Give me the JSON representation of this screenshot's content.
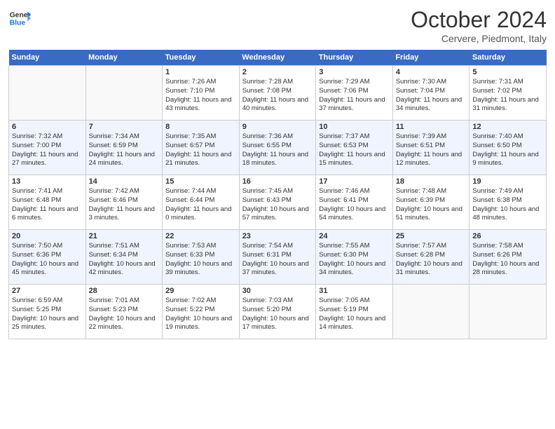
{
  "header": {
    "logo_line1": "General",
    "logo_line2": "Blue",
    "title": "October 2024",
    "location": "Cervere, Piedmont, Italy"
  },
  "weekdays": [
    "Sunday",
    "Monday",
    "Tuesday",
    "Wednesday",
    "Thursday",
    "Friday",
    "Saturday"
  ],
  "weeks": [
    [
      {
        "day": "",
        "info": ""
      },
      {
        "day": "",
        "info": ""
      },
      {
        "day": "1",
        "info": "Sunrise: 7:26 AM\nSunset: 7:10 PM\nDaylight: 11 hours and 43 minutes."
      },
      {
        "day": "2",
        "info": "Sunrise: 7:28 AM\nSunset: 7:08 PM\nDaylight: 11 hours and 40 minutes."
      },
      {
        "day": "3",
        "info": "Sunrise: 7:29 AM\nSunset: 7:06 PM\nDaylight: 11 hours and 37 minutes."
      },
      {
        "day": "4",
        "info": "Sunrise: 7:30 AM\nSunset: 7:04 PM\nDaylight: 11 hours and 34 minutes."
      },
      {
        "day": "5",
        "info": "Sunrise: 7:31 AM\nSunset: 7:02 PM\nDaylight: 11 hours and 31 minutes."
      }
    ],
    [
      {
        "day": "6",
        "info": "Sunrise: 7:32 AM\nSunset: 7:00 PM\nDaylight: 11 hours and 27 minutes."
      },
      {
        "day": "7",
        "info": "Sunrise: 7:34 AM\nSunset: 6:59 PM\nDaylight: 11 hours and 24 minutes."
      },
      {
        "day": "8",
        "info": "Sunrise: 7:35 AM\nSunset: 6:57 PM\nDaylight: 11 hours and 21 minutes."
      },
      {
        "day": "9",
        "info": "Sunrise: 7:36 AM\nSunset: 6:55 PM\nDaylight: 11 hours and 18 minutes."
      },
      {
        "day": "10",
        "info": "Sunrise: 7:37 AM\nSunset: 6:53 PM\nDaylight: 11 hours and 15 minutes."
      },
      {
        "day": "11",
        "info": "Sunrise: 7:39 AM\nSunset: 6:51 PM\nDaylight: 11 hours and 12 minutes."
      },
      {
        "day": "12",
        "info": "Sunrise: 7:40 AM\nSunset: 6:50 PM\nDaylight: 11 hours and 9 minutes."
      }
    ],
    [
      {
        "day": "13",
        "info": "Sunrise: 7:41 AM\nSunset: 6:48 PM\nDaylight: 11 hours and 6 minutes."
      },
      {
        "day": "14",
        "info": "Sunrise: 7:42 AM\nSunset: 6:46 PM\nDaylight: 11 hours and 3 minutes."
      },
      {
        "day": "15",
        "info": "Sunrise: 7:44 AM\nSunset: 6:44 PM\nDaylight: 11 hours and 0 minutes."
      },
      {
        "day": "16",
        "info": "Sunrise: 7:45 AM\nSunset: 6:43 PM\nDaylight: 10 hours and 57 minutes."
      },
      {
        "day": "17",
        "info": "Sunrise: 7:46 AM\nSunset: 6:41 PM\nDaylight: 10 hours and 54 minutes."
      },
      {
        "day": "18",
        "info": "Sunrise: 7:48 AM\nSunset: 6:39 PM\nDaylight: 10 hours and 51 minutes."
      },
      {
        "day": "19",
        "info": "Sunrise: 7:49 AM\nSunset: 6:38 PM\nDaylight: 10 hours and 48 minutes."
      }
    ],
    [
      {
        "day": "20",
        "info": "Sunrise: 7:50 AM\nSunset: 6:36 PM\nDaylight: 10 hours and 45 minutes."
      },
      {
        "day": "21",
        "info": "Sunrise: 7:51 AM\nSunset: 6:34 PM\nDaylight: 10 hours and 42 minutes."
      },
      {
        "day": "22",
        "info": "Sunrise: 7:53 AM\nSunset: 6:33 PM\nDaylight: 10 hours and 39 minutes."
      },
      {
        "day": "23",
        "info": "Sunrise: 7:54 AM\nSunset: 6:31 PM\nDaylight: 10 hours and 37 minutes."
      },
      {
        "day": "24",
        "info": "Sunrise: 7:55 AM\nSunset: 6:30 PM\nDaylight: 10 hours and 34 minutes."
      },
      {
        "day": "25",
        "info": "Sunrise: 7:57 AM\nSunset: 6:28 PM\nDaylight: 10 hours and 31 minutes."
      },
      {
        "day": "26",
        "info": "Sunrise: 7:58 AM\nSunset: 6:26 PM\nDaylight: 10 hours and 28 minutes."
      }
    ],
    [
      {
        "day": "27",
        "info": "Sunrise: 6:59 AM\nSunset: 5:25 PM\nDaylight: 10 hours and 25 minutes."
      },
      {
        "day": "28",
        "info": "Sunrise: 7:01 AM\nSunset: 5:23 PM\nDaylight: 10 hours and 22 minutes."
      },
      {
        "day": "29",
        "info": "Sunrise: 7:02 AM\nSunset: 5:22 PM\nDaylight: 10 hours and 19 minutes."
      },
      {
        "day": "30",
        "info": "Sunrise: 7:03 AM\nSunset: 5:20 PM\nDaylight: 10 hours and 17 minutes."
      },
      {
        "day": "31",
        "info": "Sunrise: 7:05 AM\nSunset: 5:19 PM\nDaylight: 10 hours and 14 minutes."
      },
      {
        "day": "",
        "info": ""
      },
      {
        "day": "",
        "info": ""
      }
    ]
  ]
}
